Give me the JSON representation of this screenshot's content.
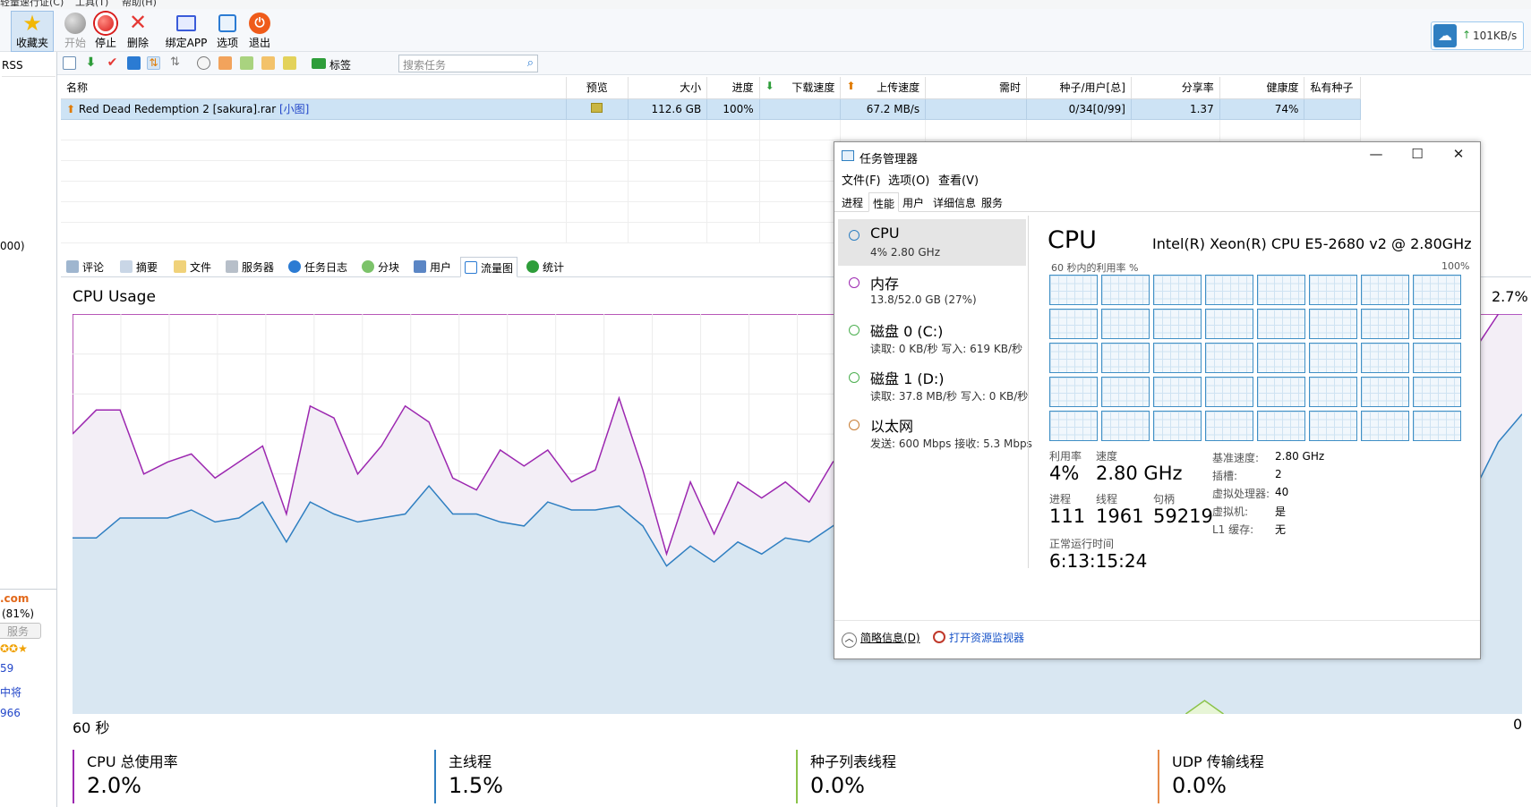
{
  "menu": {
    "items": [
      "轻量速行证(C)",
      "工具(T)",
      "帮助(H)"
    ]
  },
  "toolbar": {
    "buttons": [
      {
        "label": "收藏夹",
        "icon": "star-icon",
        "color": "#f2b705"
      },
      {
        "label": "开始",
        "icon": "play-icon",
        "color": "#9a9a9a"
      },
      {
        "label": "停止",
        "icon": "stop-icon",
        "color": "#e53935"
      },
      {
        "label": "删除",
        "icon": "delete-icon",
        "color": "#e53935"
      },
      {
        "label": "绑定APP",
        "icon": "bind-app-icon",
        "color": "#3a5bd9"
      },
      {
        "label": "选项",
        "icon": "options-icon",
        "color": "#2b7bd3"
      },
      {
        "label": "退出",
        "icon": "power-icon",
        "color": "#ef5b1a"
      }
    ]
  },
  "speed": {
    "value": "101KB/s",
    "arrow": "↑"
  },
  "sidebar": {
    "rss": "RSS",
    "items": [
      "000)",
      ".com",
      "(81%)",
      "服务",
      "59",
      "中将",
      "966"
    ]
  },
  "toolbar2": {
    "tag_label": "标签",
    "search_placeholder": "搜索任务"
  },
  "torrent_table": {
    "columns": [
      "名称",
      "预览",
      "大小",
      "进度",
      "下载速度",
      "上传速度",
      "需时",
      "种子/用户[总]",
      "分享率",
      "健康度",
      "私有种子"
    ],
    "rows": [
      {
        "name": "Red Dead Redemption 2 [sakura].rar",
        "tag": "[小图]",
        "size": "112.6 GB",
        "progress": "100%",
        "down": "",
        "up": "67.2 MB/s",
        "eta": "",
        "seeds": "0/34[0/99]",
        "ratio": "1.37",
        "health": "74%",
        "private": ""
      }
    ]
  },
  "tabs": [
    "评论",
    "摘要",
    "文件",
    "服务器",
    "任务日志",
    "分块",
    "用户",
    "流量图",
    "统计"
  ],
  "chart": {
    "title": "CPU Usage",
    "current": "2.7%",
    "x_left": "60 秒",
    "x_right": "0"
  },
  "chart_data": {
    "type": "area",
    "title": "CPU Usage",
    "x_range": [
      60,
      0
    ],
    "series": [
      {
        "name": "CPU 总使用率",
        "color": "#9c27b0",
        "values": [
          26,
          32,
          27,
          11,
          14,
          14,
          11,
          14,
          14,
          7,
          24,
          24,
          12,
          18,
          27,
          16,
          9,
          6,
          18,
          15,
          13,
          7,
          10,
          27,
          14,
          3,
          16,
          7,
          15,
          14,
          14,
          10,
          16,
          16,
          14,
          16,
          16,
          14,
          9,
          10,
          14,
          18,
          20,
          14,
          20,
          26,
          29,
          31,
          26,
          17,
          15,
          16,
          15,
          16,
          17,
          18,
          17,
          20,
          22,
          35
        ]
      },
      {
        "name": "主线程",
        "color": "#2f7fc1",
        "values": [
          2,
          4,
          3,
          2,
          3,
          2,
          2,
          3,
          3,
          2,
          4,
          4,
          2,
          3,
          3,
          2,
          2,
          2,
          3,
          2,
          2,
          2,
          2,
          3,
          2,
          1,
          2,
          1,
          2,
          2,
          2,
          2,
          3,
          3,
          2,
          2,
          2,
          2,
          2,
          2,
          2,
          3,
          3,
          2,
          3,
          4,
          5,
          6,
          4,
          3,
          2,
          2,
          2,
          2,
          3,
          3,
          3,
          3,
          4,
          1.5
        ]
      }
    ],
    "blue_area": [
      56,
      56,
      51,
      51,
      51,
      49,
      52,
      51,
      47,
      57,
      47,
      50,
      52,
      51,
      50,
      43,
      50,
      50,
      52,
      53,
      47,
      49,
      49,
      48,
      53,
      63,
      58,
      62,
      57,
      60,
      56,
      57,
      53,
      49,
      50,
      48,
      48,
      50,
      50,
      49,
      48,
      50,
      47,
      50,
      48,
      50,
      46,
      43,
      45,
      50,
      53,
      48,
      45,
      48,
      46,
      47,
      48,
      45,
      43,
      44,
      32,
      25
    ]
  },
  "legend": [
    {
      "label": "CPU 总使用率",
      "value": "2.0%",
      "color": "#9c27b0"
    },
    {
      "label": "主线程",
      "value": "1.5%",
      "color": "#2f7fc1"
    },
    {
      "label": "种子列表线程",
      "value": "0.0%",
      "color": "#8bc34a"
    },
    {
      "label": "UDP 传输线程",
      "value": "0.0%",
      "color": "#e58b4a"
    }
  ],
  "task_manager": {
    "title": "任务管理器",
    "menu": [
      "文件(F)",
      "选项(O)",
      "查看(V)"
    ],
    "tabs": [
      "进程",
      "性能",
      "用户",
      "详细信息",
      "服务"
    ],
    "resources": [
      {
        "name": "CPU",
        "sub": "4% 2.80 GHz",
        "color": "#2f7fc1"
      },
      {
        "name": "内存",
        "sub": "13.8/52.0 GB (27%)",
        "color": "#9c27b0"
      },
      {
        "name": "磁盘 0 (C:)",
        "sub": "读取: 0 KB/秒  写入: 619 KB/秒",
        "color": "#4caf50"
      },
      {
        "name": "磁盘 1 (D:)",
        "sub": "读取: 37.8 MB/秒  写入: 0 KB/秒",
        "color": "#4caf50"
      },
      {
        "name": "以太网",
        "sub": "发送: 600 Mbps  接收: 5.3 Mbps",
        "color": "#c87d34"
      }
    ],
    "heading": "CPU",
    "cpu_name": "Intel(R) Xeon(R) CPU E5-2680 v2 @ 2.80GHz",
    "graph_label": "60 秒内的利用率 %",
    "graph_max": "100%",
    "stats": {
      "util_label": "利用率",
      "util": "4%",
      "speed_label": "速度",
      "speed": "2.80 GHz",
      "proc_label": "进程",
      "proc": "111",
      "thread_label": "线程",
      "thread": "1961",
      "handle_label": "句柄",
      "handle": "59219",
      "uptime_label": "正常运行时间",
      "uptime": "6:13:15:24"
    },
    "specs": [
      {
        "k": "基准速度:",
        "v": "2.80 GHz"
      },
      {
        "k": "插槽:",
        "v": "2"
      },
      {
        "k": "虚拟处理器:",
        "v": "40"
      },
      {
        "k": "虚拟机:",
        "v": "是"
      },
      {
        "k": "L1 缓存:",
        "v": "无"
      }
    ],
    "footer": {
      "brief": "简略信息(D)",
      "monitor": "打开资源监视器"
    }
  }
}
